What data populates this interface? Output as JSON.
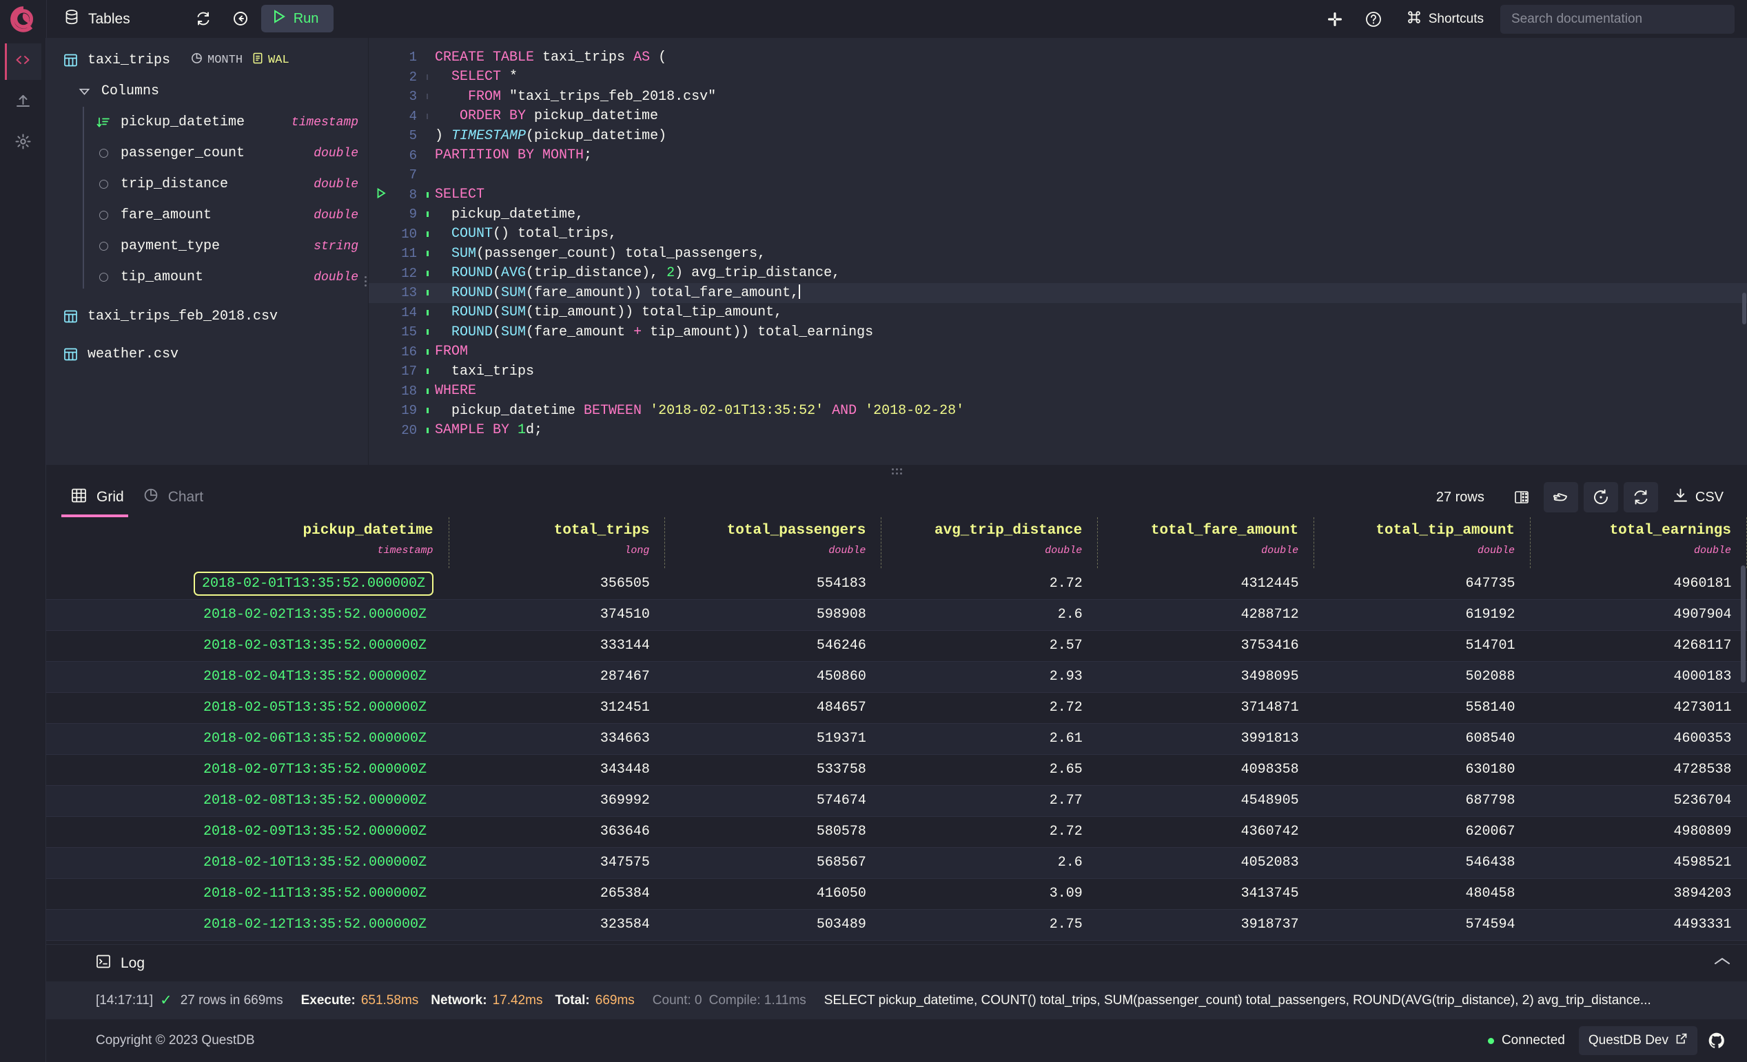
{
  "topbar": {
    "logo_icon": "questdb-logo-icon",
    "tables_label": "Tables",
    "tables_icon": "database-icon",
    "refresh_icon": "refresh-icon",
    "collapse_icon": "arrow-left-circle-icon",
    "run_label": "Run",
    "run_icon": "play-icon",
    "slack_icon": "slack-icon",
    "help_icon": "question-circle-icon",
    "shortcuts_label": "Shortcuts",
    "shortcuts_icon": "command-icon",
    "doc_search_placeholder": "Search documentation",
    "doc_search_value": ""
  },
  "rail": {
    "items": [
      {
        "name": "code-icon",
        "label": ""
      },
      {
        "name": "upload-icon",
        "label": ""
      },
      {
        "name": "gear-icon",
        "label": ""
      }
    ]
  },
  "schema": {
    "table": {
      "name": "taxi_trips",
      "icon": "table-icon",
      "partition_badge": "MONTH",
      "partition_icon": "pie-chart-icon",
      "wal_badge": "WAL",
      "wal_icon": "list-icon"
    },
    "columns_label": "Columns",
    "columns_caret": "caret-down-icon",
    "columns": [
      {
        "name": "pickup_datetime",
        "type": "timestamp",
        "icon": "sort-designated-timestamp-icon"
      },
      {
        "name": "passenger_count",
        "type": "double",
        "icon": "circle-icon"
      },
      {
        "name": "trip_distance",
        "type": "double",
        "icon": "circle-icon"
      },
      {
        "name": "fare_amount",
        "type": "double",
        "icon": "circle-icon"
      },
      {
        "name": "payment_type",
        "type": "string",
        "icon": "circle-icon"
      },
      {
        "name": "tip_amount",
        "type": "double",
        "icon": "circle-icon"
      }
    ],
    "other_tables": [
      {
        "name": "taxi_trips_feb_2018.csv",
        "icon": "table-icon"
      },
      {
        "name": "weather.csv",
        "icon": "table-icon"
      }
    ]
  },
  "editor": {
    "active_line": 13,
    "run_marker_line": 8,
    "lines": [
      {
        "no": 1,
        "tokens": [
          {
            "t": "CREATE TABLE ",
            "c": "k"
          },
          {
            "t": "taxi_trips ",
            "c": "p"
          },
          {
            "t": "AS",
            "c": "k"
          },
          {
            "t": " (",
            "c": "p"
          }
        ]
      },
      {
        "no": 2,
        "indent": 1,
        "tokens": [
          {
            "t": "  SELECT ",
            "c": "k"
          },
          {
            "t": "*",
            "c": "p"
          }
        ]
      },
      {
        "no": 3,
        "indent": 1,
        "tokens": [
          {
            "t": "    FROM ",
            "c": "k"
          },
          {
            "t": "\"taxi_trips_feb_2018.csv\"",
            "c": "p"
          }
        ]
      },
      {
        "no": 4,
        "indent": 1,
        "tokens": [
          {
            "t": "   ORDER BY ",
            "c": "k"
          },
          {
            "t": "pickup_datetime",
            "c": "p"
          }
        ]
      },
      {
        "no": 5,
        "tokens": [
          {
            "t": ") ",
            "c": "p"
          },
          {
            "t": "TIMESTAMP",
            "c": "i"
          },
          {
            "t": "(pickup_datetime)",
            "c": "p"
          }
        ]
      },
      {
        "no": 6,
        "tokens": [
          {
            "t": "PARTITION BY MONTH",
            "c": "k"
          },
          {
            "t": ";",
            "c": "p"
          }
        ]
      },
      {
        "no": 7,
        "tokens": []
      },
      {
        "no": 8,
        "tokens": [
          {
            "t": "SELECT",
            "c": "k"
          }
        ]
      },
      {
        "no": 9,
        "indent": 1,
        "tokens": [
          {
            "t": "  pickup_datetime,",
            "c": "p"
          }
        ]
      },
      {
        "no": 10,
        "indent": 1,
        "tokens": [
          {
            "t": "  COUNT",
            "c": "f"
          },
          {
            "t": "() total_trips,",
            "c": "p"
          }
        ]
      },
      {
        "no": 11,
        "indent": 1,
        "tokens": [
          {
            "t": "  SUM",
            "c": "f"
          },
          {
            "t": "(passenger_count) total_passengers,",
            "c": "p"
          }
        ]
      },
      {
        "no": 12,
        "indent": 1,
        "tokens": [
          {
            "t": "  ROUND",
            "c": "f"
          },
          {
            "t": "(",
            "c": "p"
          },
          {
            "t": "AVG",
            "c": "f"
          },
          {
            "t": "(trip_distance), ",
            "c": "p"
          },
          {
            "t": "2",
            "c": "n"
          },
          {
            "t": ") avg_trip_distance,",
            "c": "p"
          }
        ]
      },
      {
        "no": 13,
        "indent": 1,
        "tokens": [
          {
            "t": "  ROUND",
            "c": "f"
          },
          {
            "t": "(",
            "c": "p"
          },
          {
            "t": "SUM",
            "c": "f"
          },
          {
            "t": "(fare_amount)) total_fare_amount,",
            "c": "p"
          }
        ]
      },
      {
        "no": 14,
        "indent": 1,
        "tokens": [
          {
            "t": "  ROUND",
            "c": "f"
          },
          {
            "t": "(",
            "c": "p"
          },
          {
            "t": "SUM",
            "c": "f"
          },
          {
            "t": "(tip_amount)) total_tip_amount,",
            "c": "p"
          }
        ]
      },
      {
        "no": 15,
        "indent": 1,
        "tokens": [
          {
            "t": "  ROUND",
            "c": "f"
          },
          {
            "t": "(",
            "c": "p"
          },
          {
            "t": "SUM",
            "c": "f"
          },
          {
            "t": "(fare_amount ",
            "c": "p"
          },
          {
            "t": "+",
            "c": "k"
          },
          {
            "t": " tip_amount)) total_earnings",
            "c": "p"
          }
        ]
      },
      {
        "no": 16,
        "tokens": [
          {
            "t": "FROM",
            "c": "k"
          }
        ]
      },
      {
        "no": 17,
        "indent": 1,
        "tokens": [
          {
            "t": "  taxi_trips",
            "c": "p"
          }
        ]
      },
      {
        "no": 18,
        "tokens": [
          {
            "t": "WHERE",
            "c": "k"
          }
        ]
      },
      {
        "no": 19,
        "indent": 1,
        "tokens": [
          {
            "t": "  pickup_datetime ",
            "c": "p"
          },
          {
            "t": "BETWEEN",
            "c": "k"
          },
          {
            "t": " '2018-02-01T13:35:52'",
            "c": "s"
          },
          {
            "t": " AND",
            "c": "k"
          },
          {
            "t": " '2018-02-28'",
            "c": "s"
          }
        ]
      },
      {
        "no": 20,
        "tokens": [
          {
            "t": "SAMPLE BY ",
            "c": "k"
          },
          {
            "t": "1",
            "c": "n"
          },
          {
            "t": "d;",
            "c": "p"
          }
        ]
      }
    ]
  },
  "results": {
    "tabs": [
      {
        "label": "Grid",
        "icon": "grid-icon",
        "active": true
      },
      {
        "label": "Chart",
        "icon": "pie-chart-icon",
        "active": false
      }
    ],
    "row_count_label": "27 rows",
    "tools": [
      {
        "name": "freeze-columns-icon",
        "label": "",
        "boxed": false
      },
      {
        "name": "hand-pointer-icon",
        "label": "",
        "boxed": true
      },
      {
        "name": "history-icon",
        "label": "",
        "boxed": true
      },
      {
        "name": "refresh-icon",
        "label": "",
        "boxed": true
      },
      {
        "name": "download-csv-button",
        "label": "CSV",
        "boxed": false
      }
    ],
    "columns": [
      {
        "name": "pickup_datetime",
        "type": "timestamp"
      },
      {
        "name": "total_trips",
        "type": "long"
      },
      {
        "name": "total_passengers",
        "type": "double"
      },
      {
        "name": "avg_trip_distance",
        "type": "double"
      },
      {
        "name": "total_fare_amount",
        "type": "double"
      },
      {
        "name": "total_tip_amount",
        "type": "double"
      },
      {
        "name": "total_earnings",
        "type": "double"
      }
    ],
    "rows": [
      [
        "2018-02-01T13:35:52.000000Z",
        "356505",
        "554183",
        "2.72",
        "4312445",
        "647735",
        "4960181"
      ],
      [
        "2018-02-02T13:35:52.000000Z",
        "374510",
        "598908",
        "2.6",
        "4288712",
        "619192",
        "4907904"
      ],
      [
        "2018-02-03T13:35:52.000000Z",
        "333144",
        "546246",
        "2.57",
        "3753416",
        "514701",
        "4268117"
      ],
      [
        "2018-02-04T13:35:52.000000Z",
        "287467",
        "450860",
        "2.93",
        "3498095",
        "502088",
        "4000183"
      ],
      [
        "2018-02-05T13:35:52.000000Z",
        "312451",
        "484657",
        "2.72",
        "3714871",
        "558140",
        "4273011"
      ],
      [
        "2018-02-06T13:35:52.000000Z",
        "334663",
        "519371",
        "2.61",
        "3991813",
        "608540",
        "4600353"
      ],
      [
        "2018-02-07T13:35:52.000000Z",
        "343448",
        "533758",
        "2.65",
        "4098358",
        "630180",
        "4728538"
      ],
      [
        "2018-02-08T13:35:52.000000Z",
        "369992",
        "574674",
        "2.77",
        "4548905",
        "687798",
        "5236704"
      ],
      [
        "2018-02-09T13:35:52.000000Z",
        "363646",
        "580578",
        "2.72",
        "4360742",
        "620067",
        "4980809"
      ],
      [
        "2018-02-10T13:35:52.000000Z",
        "347575",
        "568567",
        "2.6",
        "4052083",
        "546438",
        "4598521"
      ],
      [
        "2018-02-11T13:35:52.000000Z",
        "265384",
        "416050",
        "3.09",
        "3413745",
        "480458",
        "3894203"
      ],
      [
        "2018-02-12T13:35:52.000000Z",
        "323584",
        "503489",
        "2.75",
        "3918737",
        "574594",
        "4493331"
      ]
    ]
  },
  "log": {
    "label": "Log",
    "icon": "terminal-icon",
    "expand_icon": "chevron-up-icon"
  },
  "status": {
    "time": "[14:17:11]",
    "ok_icon": "check-icon",
    "rows_text": "27 rows in 669ms",
    "execute_label": "Execute:",
    "execute_value": "651.58ms",
    "network_label": "Network:",
    "network_value": "17.42ms",
    "total_label": "Total:",
    "total_value": "669ms",
    "count_text": "Count: 0",
    "compile_text": "Compile: 1.11ms",
    "query_text": "SELECT pickup_datetime, COUNT() total_trips, SUM(passenger_count) total_passengers, ROUND(AVG(trip_distance), 2) avg_trip_distance..."
  },
  "footer": {
    "copyright": "Copyright © 2023 QuestDB",
    "connected_label": "Connected",
    "instance_label": "QuestDB Dev",
    "external_icon": "external-link-icon",
    "github_icon": "github-icon"
  },
  "colors": {
    "accent_pink": "#ff79c6",
    "brand_magenta": "#d14671",
    "green": "#50fa7b",
    "yellow": "#f1fa8c",
    "cyan": "#8be9fd",
    "orange": "#ffb86c",
    "bg_dark": "#21222c",
    "bg_panel": "#282a36"
  }
}
